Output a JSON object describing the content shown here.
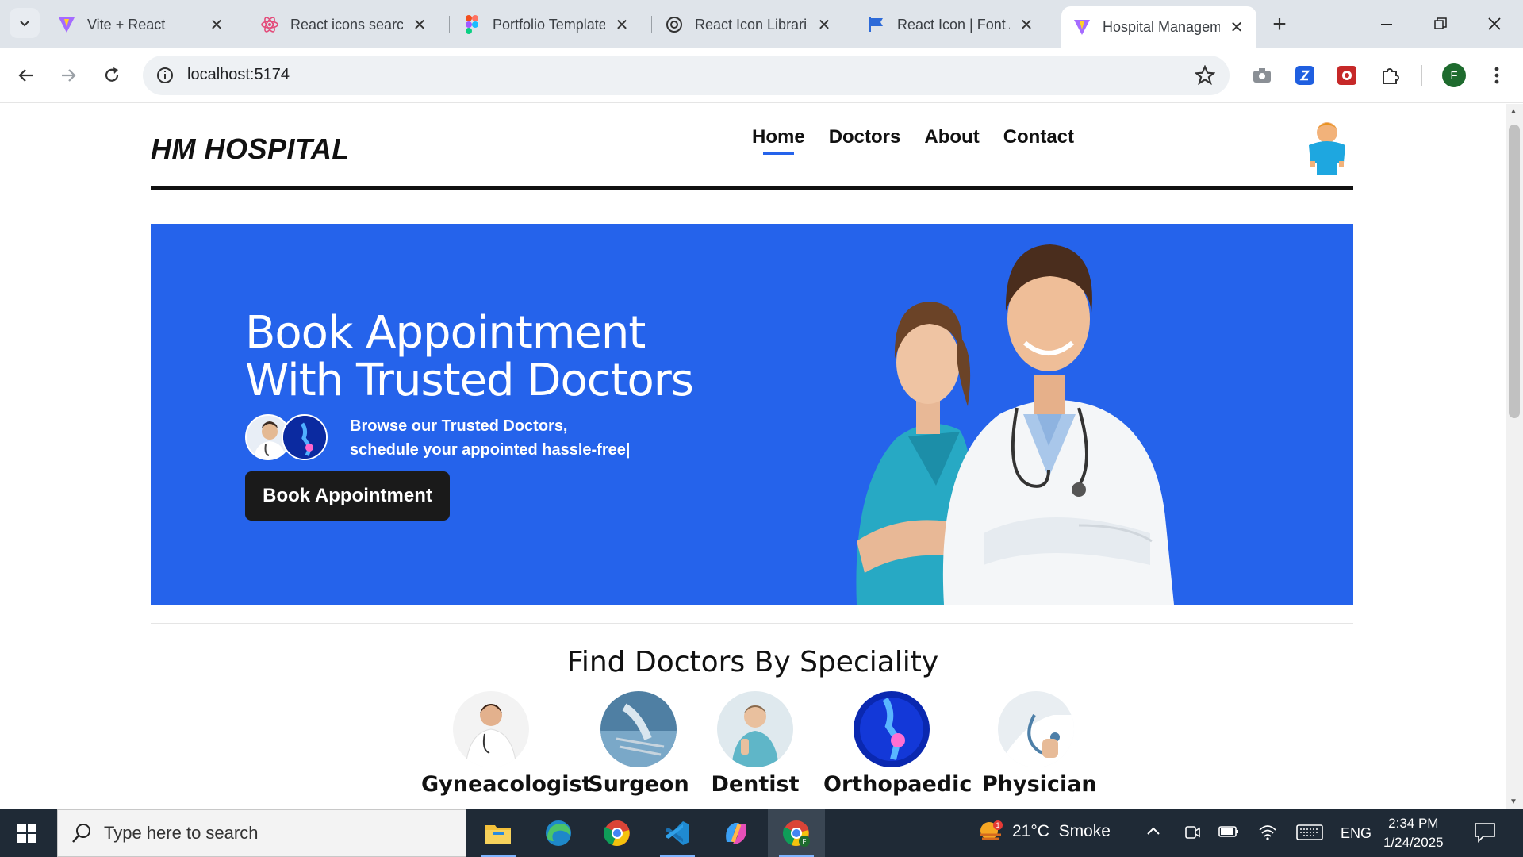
{
  "browser": {
    "tabs": [
      {
        "label": "Vite + React",
        "icon": "vite-icon"
      },
      {
        "label": "React icons search",
        "icon": "react-icon"
      },
      {
        "label": "Portfolio Template",
        "icon": "figma-icon"
      },
      {
        "label": "React Icon Librarie",
        "icon": "openai-icon"
      },
      {
        "label": "React Icon | Font A",
        "icon": "flag-icon"
      },
      {
        "label": "Hospital Managem",
        "icon": "vite-icon",
        "active": true
      }
    ],
    "url": "localhost:5174",
    "profile_initial": "F"
  },
  "site": {
    "logo": "HM HOSPITAL",
    "nav": [
      "Home",
      "Doctors",
      "About",
      "Contact"
    ],
    "active_nav": "Home"
  },
  "hero": {
    "title_line1": "Book Appointment",
    "title_line2": "With Trusted Doctors",
    "subtitle_line1": "Browse our Trusted Doctors,",
    "subtitle_line2": "schedule your appointed hassle-free|",
    "cta": "Book Appointment",
    "bg_color": "#2563eb"
  },
  "specialities": {
    "title": "Find Doctors By Speciality",
    "items": [
      "Gyneacologist",
      "Surgeon",
      "Dentist",
      "Orthopaedic",
      "Physician"
    ]
  },
  "taskbar": {
    "search_placeholder": "Type here to search",
    "weather": "21°C  Smoke",
    "weather_badge": "1",
    "lang": "ENG",
    "time": "2:34 PM",
    "date": "1/24/2025"
  }
}
